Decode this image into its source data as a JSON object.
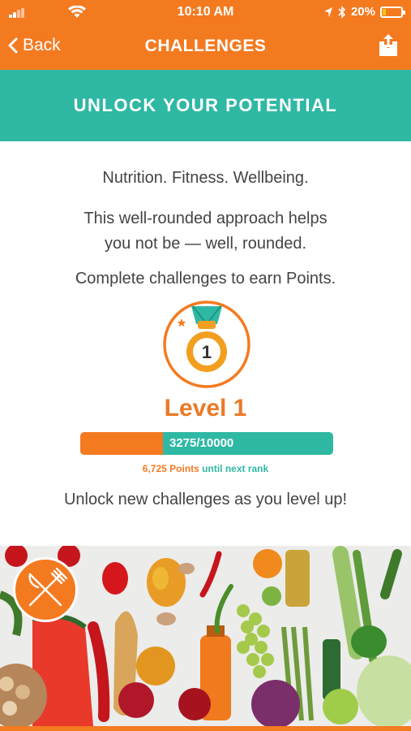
{
  "status_bar": {
    "time": "10:10 AM",
    "battery": "20%",
    "battery_level": 0.2
  },
  "nav": {
    "back_label": "Back",
    "title": "CHALLENGES",
    "share_icon": "share-icon"
  },
  "banner": {
    "title": "UNLOCK YOUR POTENTIAL"
  },
  "intro": {
    "tagline": "Nutrition. Fitness. Wellbeing.",
    "description_line1": "This well-rounded approach helps",
    "description_line2": "you not be — well, rounded.",
    "complete_text": "Complete challenges to earn Points."
  },
  "level": {
    "medal_number": "1",
    "label": "Level 1",
    "progress_text": "3275/10000",
    "progress_fraction": 0.3275,
    "points_remaining": "6,725 Points",
    "until_text": "until next rank",
    "unlock_text": "Unlock new challenges as you level up!"
  },
  "food_card": {
    "icon": "fork-knife-icon"
  },
  "colors": {
    "brand_orange": "#f47a20",
    "teal": "#2fb8a4",
    "text_gray": "#444444"
  }
}
